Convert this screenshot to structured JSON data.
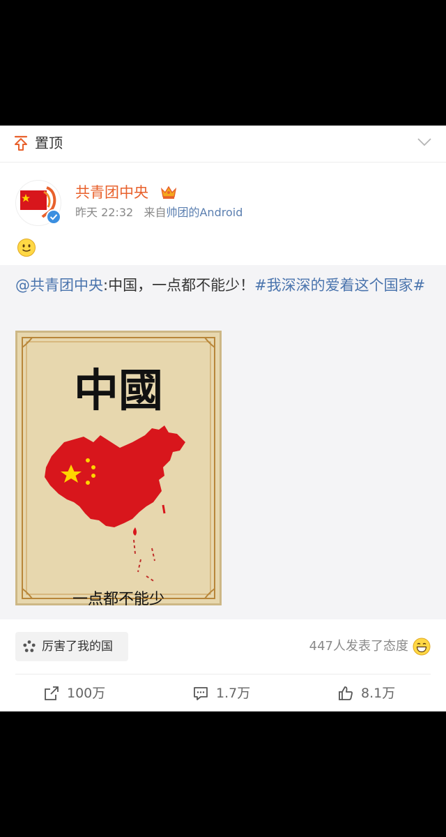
{
  "pinned": {
    "label": "置顶"
  },
  "post": {
    "user_name": "共青团中央",
    "time": "昨天 22:32",
    "source_prefix": "来自",
    "source": "帅团的Android",
    "emoji": "slightly-smiling-face"
  },
  "repost": {
    "mention": "@共青团中央",
    "text": ":中国，一点都不能少！",
    "hashtag": "#我深深的爱着这个国家#",
    "image": {
      "title_chars": "中國",
      "bottom_text": "一点都不能少"
    }
  },
  "attitude": {
    "button_label": "厉害了我的国",
    "count_text": "447人发表了态度"
  },
  "actions": {
    "repost": "100万",
    "comment": "1.7万",
    "like": "8.1万"
  },
  "colors": {
    "name": "#e8612c",
    "link": "#4a74ad",
    "flag_red": "#d8161c",
    "star_yellow": "#ffd400"
  }
}
